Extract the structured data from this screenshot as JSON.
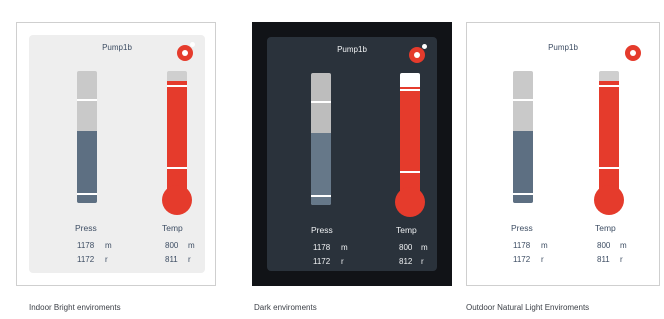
{
  "panels": [
    {
      "title": "Pump1b",
      "caption": "Indoor Bright enviroments",
      "press": {
        "label": "Press",
        "m_value": "1178",
        "m_unit": "m",
        "r_value": "1172",
        "r_unit": "r"
      },
      "temp": {
        "label": "Temp",
        "m_value": "800",
        "m_unit": "m",
        "r_value": "811",
        "r_unit": "r"
      }
    },
    {
      "title": "Pump1b",
      "caption": "Dark enviroments",
      "press": {
        "label": "Press",
        "m_value": "1178",
        "m_unit": "m",
        "r_value": "1172",
        "r_unit": "r"
      },
      "temp": {
        "label": "Temp",
        "m_value": "800",
        "m_unit": "m",
        "r_value": "812",
        "r_unit": "r"
      }
    },
    {
      "title": "Pump1b",
      "caption": "Outdoor Natural Light Enviroments",
      "press": {
        "label": "Press",
        "m_value": "1178",
        "m_unit": "m",
        "r_value": "1172",
        "r_unit": "r"
      },
      "temp": {
        "label": "Temp",
        "m_value": "800",
        "m_unit": "m",
        "r_value": "811",
        "r_unit": "r"
      }
    }
  ],
  "colors": {
    "accent_red": "#e53b2c",
    "pressure_blue": "#5d6f82",
    "dark_frame": "#111317",
    "dark_card": "#2a323b",
    "indoor_card": "#eeeeee",
    "outdoor_card": "#ffffff"
  },
  "icons": [
    "alarm-badge-icon"
  ]
}
